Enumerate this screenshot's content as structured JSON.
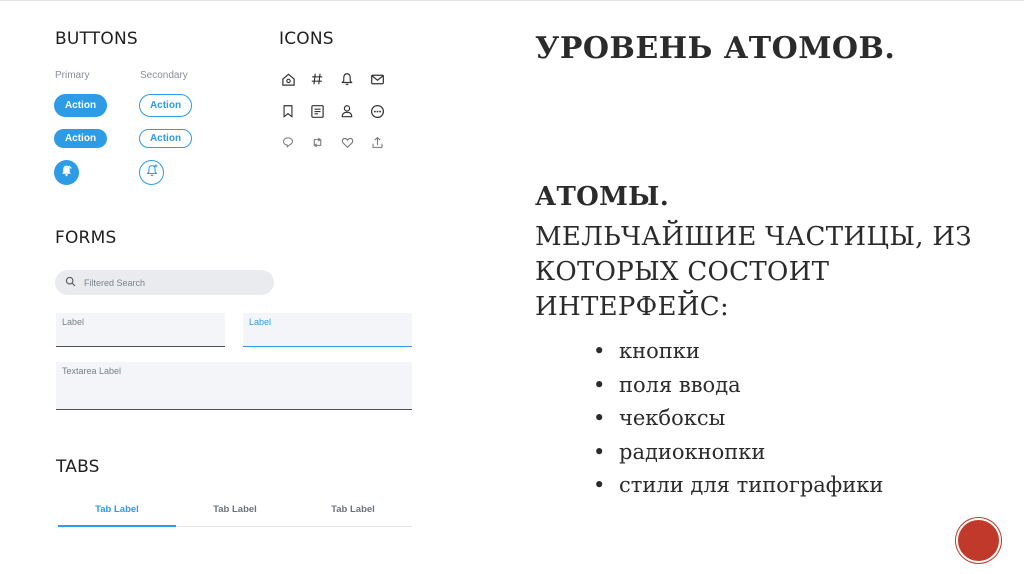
{
  "sections": {
    "buttons_title": "BUTTONS",
    "icons_title": "ICONS",
    "forms_title": "FORMS",
    "tabs_title": "TABS"
  },
  "buttons": {
    "primary_label": "Primary",
    "secondary_label": "Secondary",
    "action_label": "Action"
  },
  "icons": [
    "home-icon",
    "hashtag-icon",
    "bell-icon",
    "mail-icon",
    "bookmark-icon",
    "list-icon",
    "user-icon",
    "more-icon",
    "comment-icon",
    "retweet-icon",
    "heart-icon",
    "share-icon"
  ],
  "forms": {
    "search_placeholder": "Filtered Search",
    "field1_label": "Label",
    "field2_label": "Label",
    "textarea_label": "Textarea Label"
  },
  "tabs": [
    "Tab Label",
    "Tab Label",
    "Tab Label"
  ],
  "slide": {
    "title": "УРОВЕНЬ АТОМОВ.",
    "heading": "АТОМЫ.",
    "body": "МЕЛЬЧАЙШИЕ ЧАСТИЦЫ, ИЗ КОТОРЫХ СОСТОИТ ИНТЕРФЕЙС:",
    "bullets": [
      "кнопки",
      "поля ввода",
      "чекбоксы",
      "радиокнопки",
      "стили для типографики"
    ]
  },
  "colors": {
    "accent": "#2e9be6",
    "decor": "#c0392b",
    "text": "#2b2b2b"
  }
}
